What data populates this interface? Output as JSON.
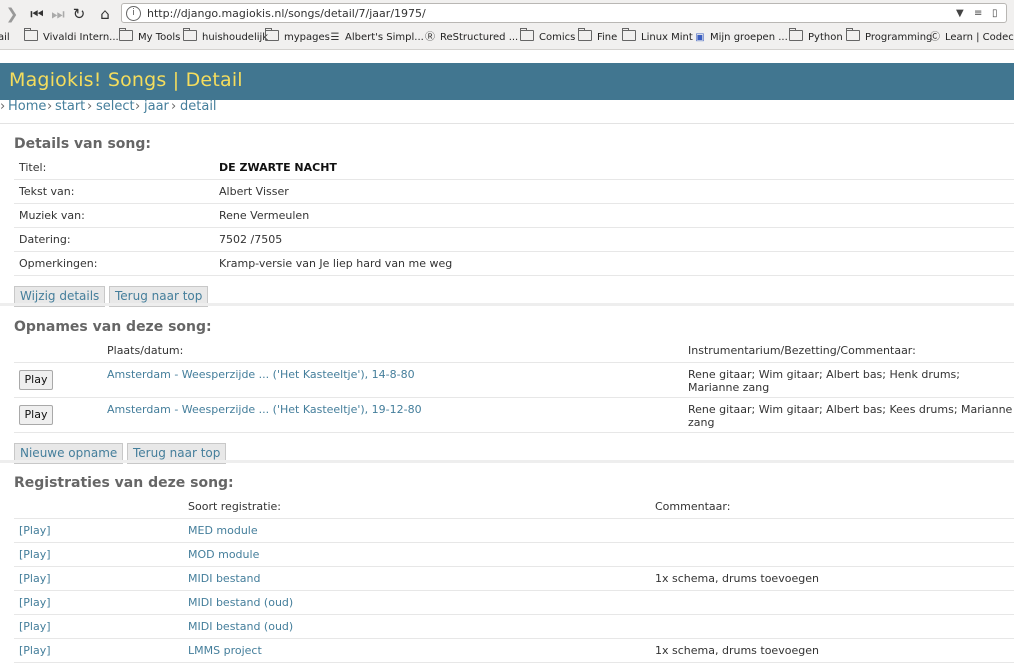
{
  "browser": {
    "url": "http://django.magiokis.nl/songs/detail/7/jaar/1975/",
    "bookmarks": [
      "ail",
      "Vivaldi Intern...",
      "My Tools",
      "huishoudelijk",
      "mypages",
      "Albert's Simpl...",
      "ReStructured ...",
      "Comics",
      "Fine",
      "Linux Mint",
      "Mijn groepen ...",
      "Python",
      "Programming",
      "Learn | Codec..."
    ]
  },
  "header": {
    "title": "Magiokis! Songs | Detail"
  },
  "breadcrumb": [
    "Home",
    "start",
    "select",
    "jaar",
    "detail"
  ],
  "details": {
    "heading": "Details van song:",
    "rows": [
      {
        "label": "Titel:",
        "value": "DE ZWARTE NACHT"
      },
      {
        "label": "Tekst van:",
        "value": "Albert Visser"
      },
      {
        "label": "Muziek van:",
        "value": "Rene Vermeulen"
      },
      {
        "label": "Datering:",
        "value": "7502 /7505"
      },
      {
        "label": "Opmerkingen:",
        "value": "Kramp-versie van Je liep hard van me weg"
      }
    ],
    "buttons": [
      "Wijzig details",
      "Terug naar top"
    ]
  },
  "opnames": {
    "heading": "Opnames van deze song:",
    "col_place": "Plaats/datum:",
    "col_instr": "Instrumentarium/Bezetting/Commentaar:",
    "play_label": "Play",
    "rows": [
      {
        "place": "Amsterdam - Weesperzijde ... ('Het Kasteeltje'), 14-8-80",
        "instr": "Rene gitaar; Wim gitaar; Albert bas; Henk drums; Marianne zang"
      },
      {
        "place": "Amsterdam - Weesperzijde ... ('Het Kasteeltje'), 19-12-80",
        "instr": "Rene gitaar; Wim gitaar; Albert bas; Kees drums; Marianne zang"
      }
    ],
    "buttons": [
      "Nieuwe opname",
      "Terug naar top"
    ]
  },
  "registraties": {
    "heading": "Registraties van deze song:",
    "col_type": "Soort registratie:",
    "col_comment": "Commentaar:",
    "play_label": "[Play]",
    "rows": [
      {
        "type": "MED module",
        "comment": ""
      },
      {
        "type": "MOD module",
        "comment": ""
      },
      {
        "type": "MIDI bestand",
        "comment": "1x schema, drums toevoegen"
      },
      {
        "type": "MIDI bestand (oud)",
        "comment": ""
      },
      {
        "type": "MIDI bestand (oud)",
        "comment": ""
      },
      {
        "type": "LMMS project",
        "comment": "1x schema, drums toevoegen"
      }
    ]
  }
}
